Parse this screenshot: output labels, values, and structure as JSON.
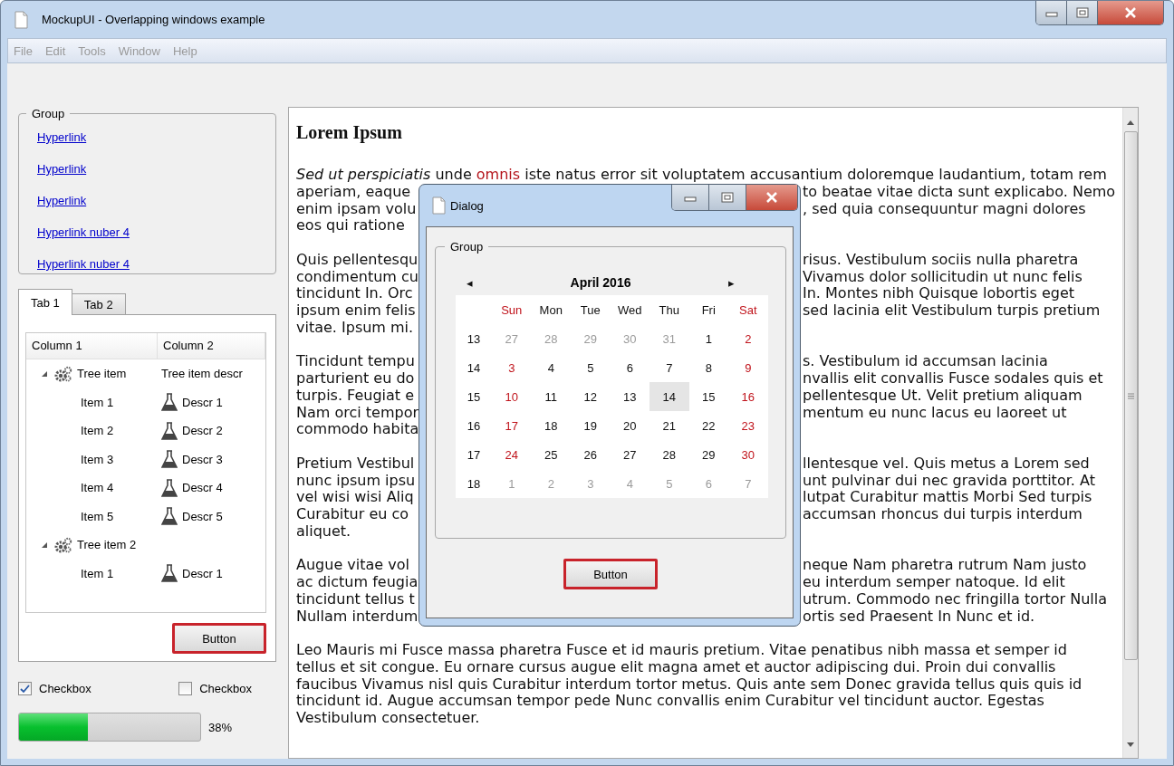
{
  "window": {
    "title": "MockupUI - Overlapping windows example"
  },
  "menu": [
    {
      "label": "File",
      "disabled": true
    },
    {
      "label": "Edit",
      "disabled": true
    },
    {
      "label": "Tools",
      "disabled": true
    },
    {
      "label": "Window",
      "disabled": true
    },
    {
      "label": "Help",
      "disabled": true
    }
  ],
  "group": {
    "title": "Group",
    "links": [
      "Hyperlink",
      "Hyperlink",
      "Hyperlink",
      "Hyperlink nuber 4",
      "Hyperlink nuber 4"
    ]
  },
  "tabs": [
    {
      "label": "Tab 1",
      "selected": true
    },
    {
      "label": "Tab 2",
      "selected": false
    }
  ],
  "tree": {
    "columns": [
      "Column 1",
      "Column 2"
    ],
    "items": [
      {
        "label": "Tree item",
        "descr": "Tree item descr",
        "expanded": true,
        "children": [
          {
            "label": "Item 1",
            "descr": "Descr 1"
          },
          {
            "label": "Item 2",
            "descr": "Descr 2"
          },
          {
            "label": "Item 3",
            "descr": "Descr 3"
          },
          {
            "label": "Item 4",
            "descr": "Descr 4"
          },
          {
            "label": "Item 5",
            "descr": "Descr 5"
          }
        ]
      },
      {
        "label": "Tree item 2",
        "expanded": true,
        "children": [
          {
            "label": "Item 1",
            "descr": "Descr 1"
          }
        ]
      }
    ]
  },
  "tab_button": {
    "label": "Button",
    "focused": true
  },
  "checkboxes": [
    {
      "label": "Checkbox",
      "checked": true
    },
    {
      "label": "Checkbox",
      "checked": false
    }
  ],
  "progress": {
    "level": 0.38,
    "reading": "38%"
  },
  "document": {
    "heading": "Lorem Ipsum",
    "paragraphs": [
      {
        "lines": [
          {
            "parts": [
              {
                "text": "Sed ut perspiciatis",
                "kind": "italic"
              },
              {
                "text": " unde ",
                "kind": "plain"
              },
              {
                "text": "omnis",
                "kind": "highlight"
              },
              {
                "text": " iste natus error sit voluptatem accusantium doloremque laudantium, totam rem",
                "kind": "plain"
              }
            ]
          },
          {
            "left": "aperiam, eaque",
            "right": "to beatae vitae dicta sunt explicabo. Nemo"
          },
          {
            "left": "enim ipsam volu",
            "right": ", sed quia consequuntur magni dolores"
          },
          {
            "left": "eos qui ratione"
          }
        ]
      },
      {
        "lines": [
          {
            "left": "Quis pellentesqu",
            "right": "risus. Vestibulum sociis nulla pharetra"
          },
          {
            "left": "condimentum cu",
            "right": "Vivamus dolor sollicitudin ut nunc felis"
          },
          {
            "left": "tincidunt In. Orc",
            "right": "In. Montes nibh Quisque lobortis eget"
          },
          {
            "left": "ipsum enim felis",
            "right": "sed lacinia elit Vestibulum turpis pretium"
          },
          {
            "left": "vitae. Ipsum mi."
          }
        ]
      },
      {
        "lines": [
          {
            "left": "Tincidunt tempu",
            "right": "s. Vestibulum id accumsan lacinia"
          },
          {
            "left": "parturient eu do",
            "right": "nvallis elit convallis Fusce sodales quis et"
          },
          {
            "left": "turpis. Feugiat e",
            "right": "pellentesque Ut. Velit pretium aliquam"
          },
          {
            "left": "Nam orci tempor",
            "right": "mentum eu nunc lacus eu laoreet ut"
          },
          {
            "left": "commodo habita"
          }
        ]
      },
      {
        "lines": [
          {
            "left": "Pretium Vestibul",
            "right": "llentesque vel. Quis metus a Lorem sed"
          },
          {
            "left": "nunc ipsum ipsu",
            "right": "unt pulvinar dui nec gravida porttitor. At"
          },
          {
            "left": "vel wisi wisi Aliq",
            "right": "lutpat Curabitur mattis Morbi Sed turpis"
          },
          {
            "left": "Curabitur eu co",
            "right": "accumsan rhoncus dui turpis interdum"
          },
          {
            "left": "aliquet."
          }
        ]
      },
      {
        "lines": [
          {
            "left": "Augue vitae vol",
            "right": "neque Nam pharetra rutrum Nam justo"
          },
          {
            "left": "ac dictum feugia",
            "right": "eu interdum semper natoque. Id elit"
          },
          {
            "left": "tincidunt tellus t",
            "right": "utrum. Commodo nec fringilla tortor Nulla"
          },
          {
            "left": "Nullam interdum",
            "right": "ortis sed Praesent In Nunc et id."
          }
        ]
      },
      {
        "lines": [
          {
            "text": "Leo Mauris mi Fusce massa pharetra Fusce et id mauris pretium. Vitae penatibus nibh massa et semper id"
          },
          {
            "text": "tellus et sit congue. Eu ornare cursus augue elit magna amet et auctor adipiscing dui. Proin dui convallis"
          },
          {
            "text": "faucibus Vivamus nisl quis Curabitur interdum tortor metus. Quis ante sem Donec gravida tellus quis quis id"
          },
          {
            "text": "tincidunt id. Augue accumsan tempor pede Nunc convallis enim Curabitur vel tincidunt auctor. Egestas"
          },
          {
            "text": "Vestibulum consectetuer."
          }
        ]
      }
    ]
  },
  "dialog": {
    "title": "Dialog",
    "group_title": "Group",
    "calendar": {
      "month": "April 2016",
      "prev": "◂",
      "next": "▸",
      "weekdays": [
        {
          "label": "Sun",
          "weekend": true
        },
        {
          "label": "Mon",
          "weekend": false
        },
        {
          "label": "Tue",
          "weekend": false
        },
        {
          "label": "Wed",
          "weekend": false
        },
        {
          "label": "Thu",
          "weekend": false
        },
        {
          "label": "Fri",
          "weekend": false
        },
        {
          "label": "Sat",
          "weekend": true
        }
      ],
      "weeks": [
        {
          "week": "13",
          "days": [
            {
              "day": "27",
              "other_month": true,
              "selected": false
            },
            {
              "day": "28",
              "other_month": true,
              "selected": false
            },
            {
              "day": "29",
              "other_month": true,
              "selected": false
            },
            {
              "day": "30",
              "other_month": true,
              "selected": false
            },
            {
              "day": "31",
              "other_month": true,
              "selected": false
            },
            {
              "day": "1",
              "other_month": false,
              "selected": false
            },
            {
              "day": "2",
              "other_month": false,
              "selected": false
            }
          ]
        },
        {
          "week": "14",
          "days": [
            {
              "day": "3",
              "other_month": false,
              "selected": false
            },
            {
              "day": "4",
              "other_month": false,
              "selected": false
            },
            {
              "day": "5",
              "other_month": false,
              "selected": false
            },
            {
              "day": "6",
              "other_month": false,
              "selected": false
            },
            {
              "day": "7",
              "other_month": false,
              "selected": false
            },
            {
              "day": "8",
              "other_month": false,
              "selected": false
            },
            {
              "day": "9",
              "other_month": false,
              "selected": false
            }
          ]
        },
        {
          "week": "15",
          "days": [
            {
              "day": "10",
              "other_month": false,
              "selected": false
            },
            {
              "day": "11",
              "other_month": false,
              "selected": false
            },
            {
              "day": "12",
              "other_month": false,
              "selected": false
            },
            {
              "day": "13",
              "other_month": false,
              "selected": false
            },
            {
              "day": "14",
              "other_month": false,
              "selected": true
            },
            {
              "day": "15",
              "other_month": false,
              "selected": false
            },
            {
              "day": "16",
              "other_month": false,
              "selected": false
            }
          ]
        },
        {
          "week": "16",
          "days": [
            {
              "day": "17",
              "other_month": false,
              "selected": false
            },
            {
              "day": "18",
              "other_month": false,
              "selected": false
            },
            {
              "day": "19",
              "other_month": false,
              "selected": false
            },
            {
              "day": "20",
              "other_month": false,
              "selected": false
            },
            {
              "day": "21",
              "other_month": false,
              "selected": false
            },
            {
              "day": "22",
              "other_month": false,
              "selected": false
            },
            {
              "day": "23",
              "other_month": false,
              "selected": false
            }
          ]
        },
        {
          "week": "17",
          "days": [
            {
              "day": "24",
              "other_month": false,
              "selected": false
            },
            {
              "day": "25",
              "other_month": false,
              "selected": false
            },
            {
              "day": "26",
              "other_month": false,
              "selected": false
            },
            {
              "day": "27",
              "other_month": false,
              "selected": false
            },
            {
              "day": "28",
              "other_month": false,
              "selected": false
            },
            {
              "day": "29",
              "other_month": false,
              "selected": false
            },
            {
              "day": "30",
              "other_month": false,
              "selected": false
            }
          ]
        },
        {
          "week": "18",
          "days": [
            {
              "day": "1",
              "other_month": true,
              "selected": false
            },
            {
              "day": "2",
              "other_month": true,
              "selected": false
            },
            {
              "day": "3",
              "other_month": true,
              "selected": false
            },
            {
              "day": "4",
              "other_month": true,
              "selected": false
            },
            {
              "day": "5",
              "other_month": true,
              "selected": false
            },
            {
              "day": "6",
              "other_month": true,
              "selected": false
            },
            {
              "day": "7",
              "other_month": true,
              "selected": false
            }
          ]
        }
      ]
    },
    "button": {
      "label": "Button",
      "focused": true
    }
  }
}
